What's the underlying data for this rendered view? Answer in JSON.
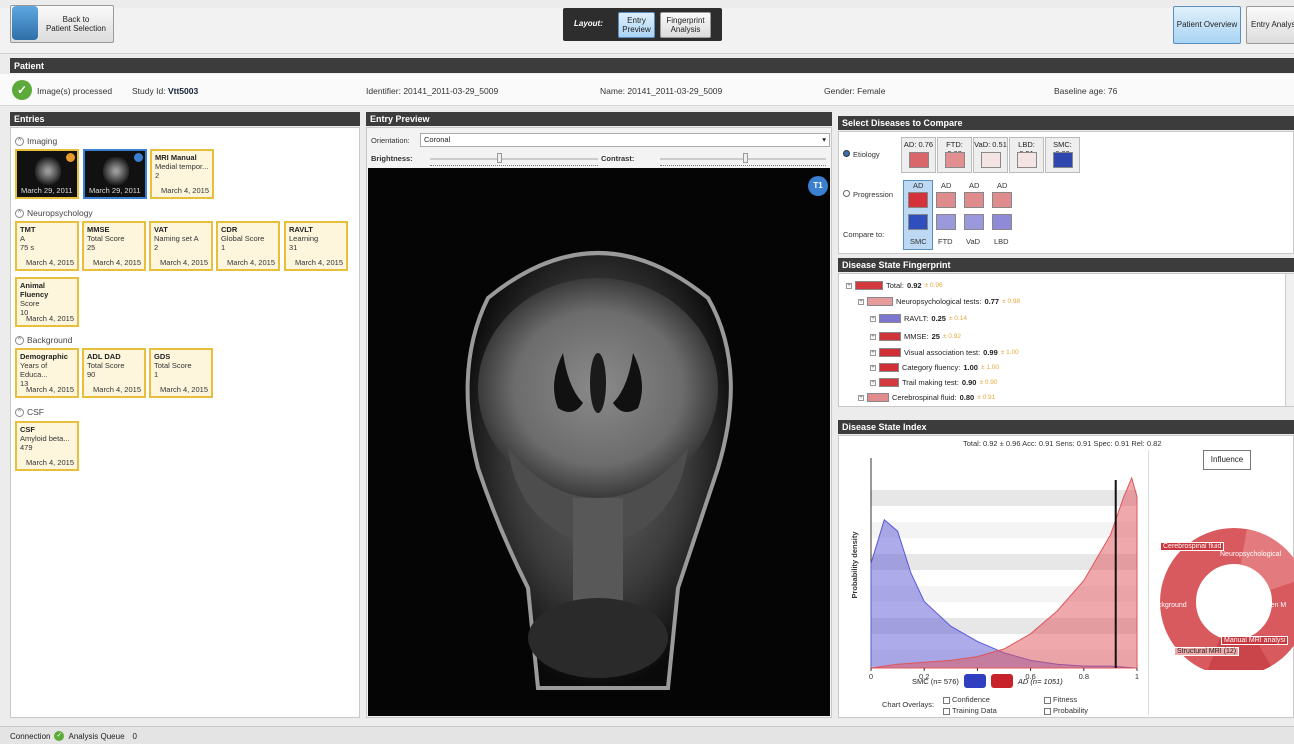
{
  "toolbar": {
    "back_label": "Back to\nPatient Selection",
    "layout_label": "Layout:",
    "entry_preview_label": "Entry\nPreview",
    "fingerprint_label": "Fingerprint\nAnalysis",
    "patient_overview_label": "Patient Overview",
    "entry_analysis_label": "Entry Analys"
  },
  "patient": {
    "header": "Patient",
    "status": "Image(s) processed",
    "study_id_label": "Study Id:",
    "study_id": "Vtt5003",
    "identifier": "Identifier: 20141_2011-03-29_5009",
    "name": "Name: 20141_2011-03-29_5009",
    "gender": "Gender: Female",
    "baseline_age": "Baseline age: 76"
  },
  "entries": {
    "header": "Entries",
    "groups": [
      "Imaging",
      "Neuropsychology",
      "Background",
      "CSF"
    ],
    "imaging": [
      {
        "date": "March 29, 2011"
      },
      {
        "date": "March 29, 2011"
      },
      {
        "title": "MRI Manual",
        "sub": "Medial tempor...",
        "value": "2",
        "date": "March 4, 2015"
      }
    ],
    "neuro": [
      {
        "title": "TMT",
        "sub": "A",
        "value": "75 s",
        "date": "March 4, 2015"
      },
      {
        "title": "MMSE",
        "sub": "Total Score",
        "value": "25",
        "date": "March 4, 2015"
      },
      {
        "title": "VAT",
        "sub": "Naming set A",
        "value": "2",
        "date": "March 4, 2015"
      },
      {
        "title": "CDR",
        "sub": "Global Score",
        "value": "1",
        "date": "March 4, 2015"
      },
      {
        "title": "RAVLT",
        "sub": "Learning",
        "value": "31",
        "date": "March 4, 2015"
      },
      {
        "title": "Animal Fluency",
        "sub": "Score",
        "value": "10",
        "date": "March 4, 2015"
      }
    ],
    "background": [
      {
        "title": "Demographic",
        "sub": "Years of Educa...",
        "value": "13",
        "date": "March 4, 2015"
      },
      {
        "title": "ADL DAD",
        "sub": "Total Score",
        "value": "90",
        "date": "March 4, 2015"
      },
      {
        "title": "GDS",
        "sub": "Total Score",
        "value": "1",
        "date": "March 4, 2015"
      }
    ],
    "csf": [
      {
        "title": "CSF",
        "sub": "Amyloid beta...",
        "value": "479",
        "date": "March 4, 2015"
      }
    ]
  },
  "preview": {
    "header": "Entry Preview",
    "orientation_label": "Orientation:",
    "orientation_value": "Coronal",
    "brightness_label": "Brightness:",
    "contrast_label": "Contrast:",
    "brightness_level": 0.4,
    "contrast_level": 0.5,
    "badge": "T1"
  },
  "compare": {
    "header": "Select Diseases to Compare",
    "etiology_label": "Etiology",
    "progression_label": "Progression",
    "compare_to_label": "Compare to:",
    "etiology": [
      {
        "label": "AD: 0.76",
        "color": "#d9666a"
      },
      {
        "label": "FTD: 0.68",
        "color": "#e18f91"
      },
      {
        "label": "VaD: 0.51",
        "color": "#f4e4e4"
      },
      {
        "label": "LBD: 0.51",
        "color": "#f4e4e4"
      },
      {
        "label": "SMC: 0.09",
        "color": "#3047b0"
      }
    ],
    "top_labels": [
      "AD",
      "AD",
      "AD",
      "AD"
    ],
    "bottom_labels": [
      "SMC",
      "FTD",
      "VaD",
      "LBD"
    ],
    "top_colors": [
      "#d4323a",
      "#e08b8e",
      "#e08b8e",
      "#e08b8e"
    ],
    "bottom_colors": [
      "#2f4fbf",
      "#9c98dc",
      "#9c98dc",
      "#8f8bd6"
    ]
  },
  "fingerprint": {
    "header": "Disease State Fingerprint",
    "rows": [
      {
        "label": "Total:",
        "val": "0.92",
        "sub": "± 0.96",
        "color": "#d23a40",
        "w": 28
      },
      {
        "label": "Neuropsychological tests:",
        "val": "0.77",
        "sub": "± 0.98",
        "color": "#e79a9c",
        "w": 26
      },
      {
        "label": "RAVLT:",
        "val": "0.25",
        "sub": "± 0.14",
        "color": "#7c78cf",
        "w": 22
      },
      {
        "label": "MMSE:",
        "val": "25",
        "sub": "± 0.92",
        "color": "#d0343b",
        "w": 22
      },
      {
        "label": "Visual association test:",
        "val": "0.99",
        "sub": "± 1.00",
        "color": "#cf2f36",
        "w": 22
      },
      {
        "label": "Category fluency:",
        "val": "1.00",
        "sub": "± 1.00",
        "color": "#cf2f36",
        "w": 20
      },
      {
        "label": "Trail making test:",
        "val": "0.90",
        "sub": "± 0.90",
        "color": "#d23a40",
        "w": 20
      },
      {
        "label": "Cerebrospinal fluid:",
        "val": "0.80",
        "sub": "± 0.91",
        "color": "#e08b8e",
        "w": 22
      }
    ]
  },
  "index": {
    "header": "Disease State Index",
    "stats": "Total: 0.92 ± 0.96  Acc: 0.91  Sens: 0.91  Spec: 0.91  Rel: 0.82",
    "influence_label": "Influence",
    "legend_smc": "SMC (n= 576)",
    "legend_ad": "AD (n= 1051)",
    "overlays_label": "Chart Overlays:",
    "overlay_options": [
      "Confidence",
      "Training Data",
      "Fitness",
      "Probability"
    ],
    "ring_labels": [
      "Cerebrospinal fluid",
      "Neuropsychological",
      "ackground",
      "Vascular burden M",
      "Manual MRI analysi",
      "Structural MRI (12)"
    ]
  },
  "chart_data": {
    "type": "area",
    "ylabel": "Probability density",
    "xlim": [
      0,
      1
    ],
    "x_ticks": [
      "0",
      "0.2",
      "0.4",
      "0.6",
      "0.8",
      "1"
    ],
    "marker_x": 0.92,
    "series": [
      {
        "name": "SMC (n= 576)",
        "color": "#5b57d6",
        "x": [
          0,
          0.05,
          0.1,
          0.15,
          0.2,
          0.3,
          0.4,
          0.5,
          0.6,
          0.7,
          0.8,
          0.9,
          1
        ],
        "y": [
          0.55,
          0.78,
          0.72,
          0.5,
          0.35,
          0.22,
          0.14,
          0.08,
          0.04,
          0.02,
          0.01,
          0.01,
          0
        ]
      },
      {
        "name": "AD (n= 1051)",
        "color": "#e0545a",
        "x": [
          0,
          0.1,
          0.2,
          0.3,
          0.4,
          0.5,
          0.6,
          0.7,
          0.8,
          0.85,
          0.9,
          0.95,
          0.98,
          1
        ],
        "y": [
          0,
          0.02,
          0.03,
          0.04,
          0.06,
          0.1,
          0.18,
          0.3,
          0.46,
          0.58,
          0.7,
          0.9,
          1,
          0.9
        ]
      }
    ]
  },
  "status": {
    "connection": "Connection",
    "queue": "Analysis Queue",
    "queue_count": "0"
  }
}
